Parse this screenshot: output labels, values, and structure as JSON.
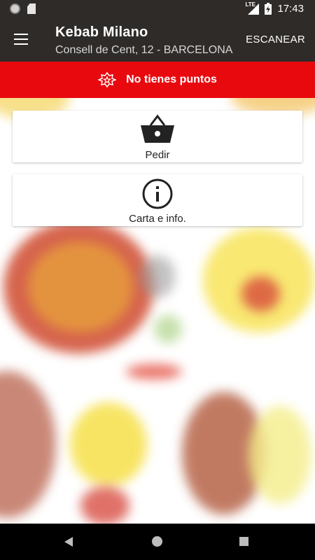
{
  "status_bar": {
    "time": "17:43",
    "network": "LTE"
  },
  "app_bar": {
    "title": "Kebab Milano",
    "subtitle": "Consell de Cent, 12 - BARCELONA",
    "scan_label": "ESCANEAR"
  },
  "points_banner": {
    "text": "No tienes puntos",
    "color": "#e8090f"
  },
  "actions": {
    "order_label": "Pedir",
    "info_label": "Carta e info."
  },
  "icons": {
    "menu": "hamburger-menu-icon",
    "points": "star-badge-icon",
    "order": "shopping-basket-icon",
    "info": "info-circle-icon"
  },
  "colors": {
    "app_bar": "#2e2b29",
    "banner": "#e8090f"
  }
}
